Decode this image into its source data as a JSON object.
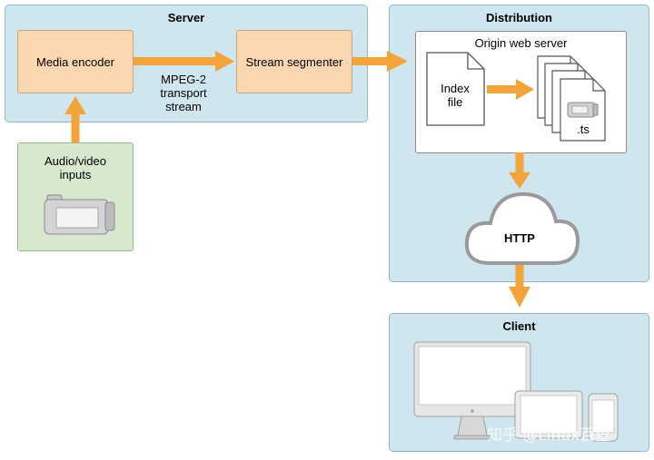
{
  "server": {
    "title": "Server",
    "encoder_label": "Media encoder",
    "segmenter_label": "Stream segmenter",
    "transport_label_line1": "MPEG-2",
    "transport_label_line2": "transport",
    "transport_label_line3": "stream"
  },
  "inputs": {
    "label_line1": "Audio/video",
    "label_line2": "inputs",
    "icon": "camcorder-icon"
  },
  "distribution": {
    "title": "Distribution",
    "origin_label": "Origin web server",
    "index_line1": "Index",
    "index_line2": "file",
    "ts_label": ".ts",
    "http_label": "HTTP"
  },
  "client": {
    "title": "Client",
    "devices": [
      "desktop-monitor-icon",
      "tablet-icon",
      "phone-icon"
    ]
  },
  "watermark": "知乎 @Linux百里",
  "colors": {
    "panel": "#cfe6ee",
    "arrow": "#f2a43a",
    "orange_box": "#fbd7b1",
    "green_box": "#d6e8cd"
  }
}
